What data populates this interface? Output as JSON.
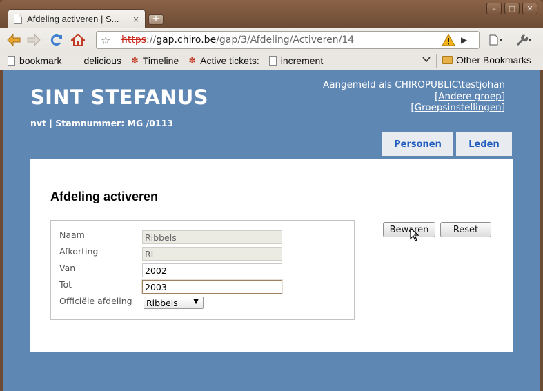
{
  "browser": {
    "tab_title": "Afdeling activeren | S...",
    "tab_close": "×",
    "new_tab": "+",
    "window_buttons": [
      "–",
      "□",
      "✕"
    ],
    "url_scheme": "https",
    "url_sep": "://",
    "url_host": "gap.chiro.be",
    "url_path": "/gap/3/Afdeling/Activeren/14",
    "bookmarks": [
      {
        "label": "bookmark",
        "icon": "page-icon"
      },
      {
        "label": "delicious",
        "icon": "delicious-icon"
      },
      {
        "label": "Timeline",
        "icon": "paw-icon"
      },
      {
        "label": "Active tickets:",
        "icon": "paw-icon"
      },
      {
        "label": "increment",
        "icon": "page-icon"
      }
    ],
    "other_bookmarks": "Other Bookmarks"
  },
  "site": {
    "title": "SINT STEFANUS",
    "subtitle": "nvt | Stamnummer: MG /0113",
    "login_text": "Aangemeld als CHIROPUBLIC\\testjohan",
    "link_other_group": "Andere groep",
    "link_group_settings": "Groepsinstellingen",
    "nav": [
      "Personen",
      "Leden"
    ]
  },
  "form": {
    "heading": "Afdeling activeren",
    "fields": [
      {
        "label": "Naam",
        "value": "Ribbels",
        "readonly": true
      },
      {
        "label": "Afkorting",
        "value": "RI",
        "readonly": true
      },
      {
        "label": "Van",
        "value": "2002",
        "readonly": false
      },
      {
        "label": "Tot",
        "value": "2003",
        "readonly": false
      }
    ],
    "official_label": "Officiële afdeling",
    "official_value": "Ribbels",
    "save_label": "Bewaren",
    "reset_label": "Reset"
  },
  "colors": {
    "page_bg": "#5f87b4",
    "nav_text": "#1f5abf",
    "url_scheme_strike": "#c8281e"
  }
}
